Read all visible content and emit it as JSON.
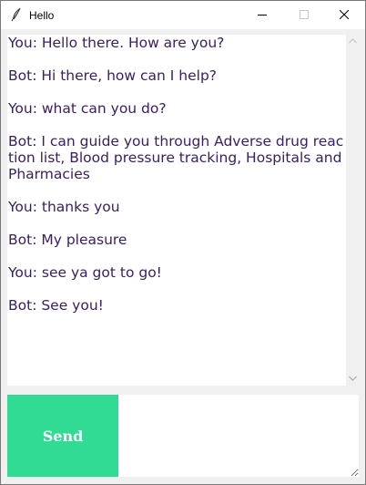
{
  "window": {
    "title": "Hello",
    "icon": "feather-icon",
    "controls": [
      "minimize-icon",
      "maximize-icon",
      "close-icon"
    ]
  },
  "chat": {
    "messages": [
      "You: Hello there. How are you?",
      "Bot: Hi there, how can I help?",
      "You: what can you do?",
      "Bot: I can guide you through Adverse drug reaction list, Blood pressure tracking, Hospitals and Pharmacies",
      "You: thanks you",
      "Bot: My pleasure",
      "You: see ya got to go!",
      "Bot: See you!"
    ]
  },
  "scrollbar": {
    "up_icon": "chevron-up-icon",
    "down_icon": "chevron-down-icon"
  },
  "input": {
    "send_label": "Send",
    "value": ""
  },
  "colors": {
    "send_button": "#32db93",
    "chat_text": "#3b2060"
  }
}
